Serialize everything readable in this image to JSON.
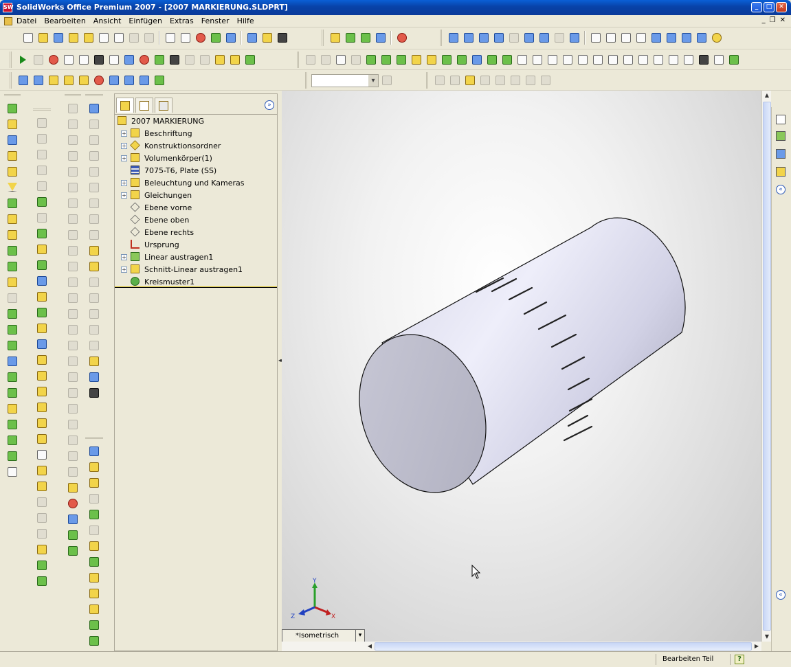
{
  "window": {
    "title": "SolidWorks Office Premium 2007 - [2007 MARKIERUNG.SLDPRT]",
    "app_icon": "SW",
    "controls": [
      "minimize-icon",
      "maximize-icon",
      "close-icon"
    ]
  },
  "menu": {
    "items": [
      "Datei",
      "Bearbeiten",
      "Ansicht",
      "Einfügen",
      "Extras",
      "Fenster",
      "Hilfe"
    ]
  },
  "feature_tree": {
    "root": "2007 MARKIERUNG",
    "items": [
      {
        "label": "Beschriftung",
        "expandable": true,
        "icon": "annotation-icon"
      },
      {
        "label": "Konstruktionsordner",
        "expandable": true,
        "icon": "design-binder-icon"
      },
      {
        "label": "Volumenkörper(1)",
        "expandable": true,
        "icon": "solid-bodies-icon"
      },
      {
        "label": "7075-T6, Plate (SS)",
        "expandable": false,
        "icon": "material-icon"
      },
      {
        "label": "Beleuchtung und Kameras",
        "expandable": true,
        "icon": "lights-icon"
      },
      {
        "label": "Gleichungen",
        "expandable": true,
        "icon": "equations-icon"
      },
      {
        "label": "Ebene vorne",
        "expandable": false,
        "icon": "plane-icon"
      },
      {
        "label": "Ebene oben",
        "expandable": false,
        "icon": "plane-icon"
      },
      {
        "label": "Ebene rechts",
        "expandable": false,
        "icon": "plane-icon"
      },
      {
        "label": "Ursprung",
        "expandable": false,
        "icon": "origin-icon"
      },
      {
        "label": "Linear austragen1",
        "expandable": true,
        "icon": "extrude-icon"
      },
      {
        "label": "Schnitt-Linear austragen1",
        "expandable": true,
        "icon": "cut-extrude-icon"
      },
      {
        "label": "Kreismuster1",
        "expandable": false,
        "icon": "circular-pattern-icon"
      }
    ]
  },
  "viewport": {
    "view_orientation": "*Isometrisch",
    "triad": {
      "x": "X",
      "y": "Y",
      "z": "Z"
    }
  },
  "statusbar": {
    "mode": "Bearbeiten Teil",
    "help_icon": "?"
  }
}
